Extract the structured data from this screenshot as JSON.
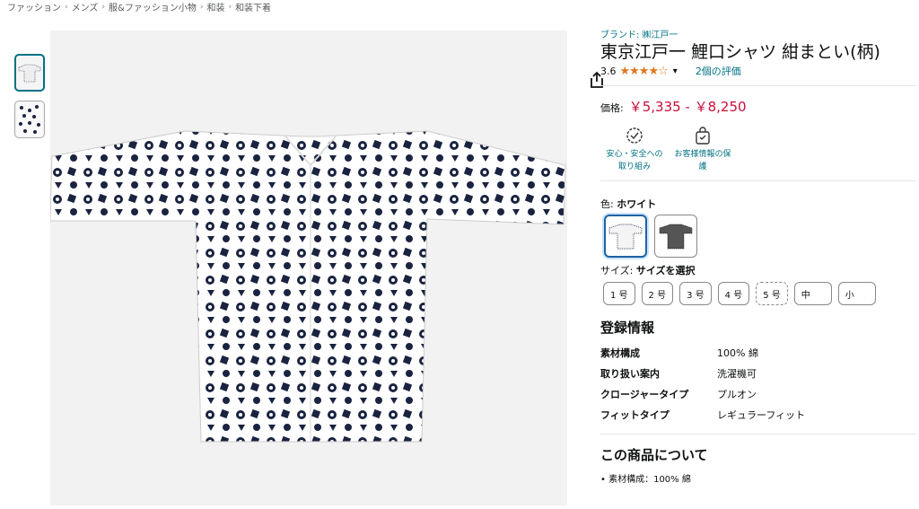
{
  "breadcrumb": [
    "ファッション",
    "メンズ",
    "服&ファッション小物",
    "和装",
    "和装下着"
  ],
  "product": {
    "brand": "ブランド: ㈱江戸一",
    "title": "東京江戸一 鯉口シャツ 紺まとい(柄)",
    "rating": "3.6",
    "stars": "★★★★☆",
    "reviews": "2個の評価",
    "price_label": "価格:",
    "price": "￥5,335 - ￥8,250"
  },
  "badges": [
    {
      "line1": "安心・安全への",
      "line2": "取り組み"
    },
    {
      "line1": "お客様情報の保",
      "line2": "護"
    }
  ],
  "color": {
    "label": "色:",
    "value": "ホワイト"
  },
  "size": {
    "label": "サイズ:",
    "value": "サイズを選択",
    "options": [
      "1 号",
      "2 号",
      "3 号",
      "4 号",
      "5 号",
      "中",
      "小"
    ]
  },
  "registration": {
    "title": "登録情報",
    "rows": [
      {
        "k": "素材構成",
        "v": "100% 綿"
      },
      {
        "k": "取り扱い案内",
        "v": "洗濯機可"
      },
      {
        "k": "クロージャータイプ",
        "v": "プルオン"
      },
      {
        "k": "フィットタイプ",
        "v": "レギュラーフィット"
      }
    ]
  },
  "about": {
    "title": "この商品について",
    "first_bullet": "素材構成：100% 綿"
  },
  "colors": {
    "link": "#007185",
    "price": "#cc0c39",
    "star": "#de7921",
    "navy": "#1a2340"
  }
}
